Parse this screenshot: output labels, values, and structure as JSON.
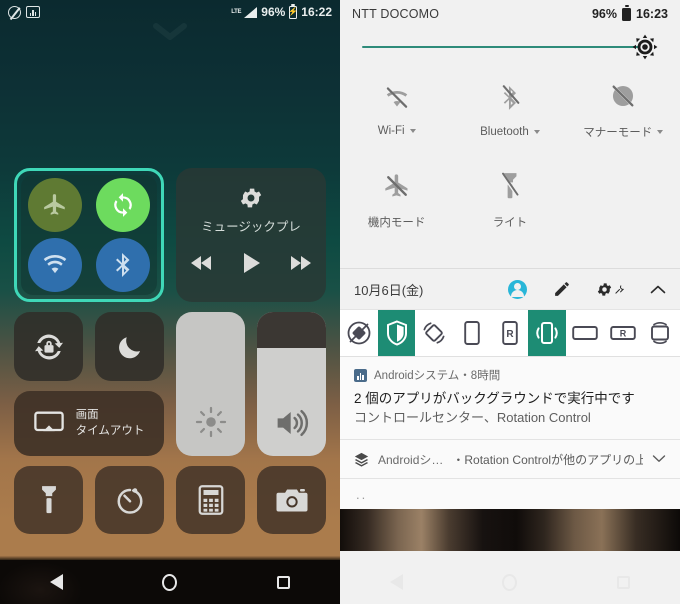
{
  "left": {
    "status_bar": {
      "dnd_icon": "do-not-disturb-icon",
      "stats_icon": "data-usage-icon",
      "network_type": "LTE",
      "battery_percent": "96%",
      "time": "16:22"
    },
    "control_center": {
      "connectivity": {
        "highlight_color": "#3fd8b8",
        "tiles": [
          {
            "name": "airplane-mode",
            "icon": "airplane-icon",
            "color": "#5f7a33",
            "state": "off"
          },
          {
            "name": "mobile-data",
            "icon": "sync-arrows-icon",
            "color": "#6ddb5e",
            "state": "on"
          },
          {
            "name": "wifi",
            "icon": "wifi-icon",
            "color": "#2f6fad",
            "state": "on"
          },
          {
            "name": "bluetooth",
            "icon": "bluetooth-icon",
            "color": "#2f6fad",
            "state": "on"
          }
        ]
      },
      "music": {
        "title": "ミュージックプレ",
        "settings_icon": "gear-icon",
        "prev_label": "previous-track",
        "play_label": "play",
        "next_label": "next-track"
      },
      "rotation_lock_icon": "rotation-lock-icon",
      "night_mode_icon": "moon-icon",
      "screen_timeout": {
        "label": "画面\nタイムアウト",
        "icon": "screen-cast-icon"
      },
      "brightness": {
        "icon": "sun-icon",
        "level": 100
      },
      "volume": {
        "icon": "speaker-icon",
        "level": 75
      },
      "shortcuts": [
        {
          "name": "flashlight",
          "icon": "flashlight-icon"
        },
        {
          "name": "timer",
          "icon": "timer-icon"
        },
        {
          "name": "calculator",
          "icon": "calculator-icon"
        },
        {
          "name": "camera",
          "icon": "camera-icon"
        }
      ]
    }
  },
  "right": {
    "status_bar": {
      "carrier": "NTT DOCOMO",
      "battery_percent": "96%",
      "time": "16:23"
    },
    "brightness_slider": {
      "value": 97,
      "icon": "brightness-icon",
      "track_color": "#2e8b7a"
    },
    "quick_settings": [
      {
        "name": "wifi",
        "label": "Wi-Fi",
        "icon": "wifi-off-icon",
        "state": "off",
        "has_caret": true
      },
      {
        "name": "bluetooth",
        "label": "Bluetooth",
        "icon": "bluetooth-off-icon",
        "state": "off",
        "has_caret": true
      },
      {
        "name": "manner-mode",
        "label": "マナーモード",
        "icon": "vibrate-off-icon",
        "state": "off",
        "has_caret": true
      },
      {
        "name": "airplane-mode",
        "label": "機内モード",
        "icon": "airplane-off-icon",
        "state": "off",
        "has_caret": false
      },
      {
        "name": "flashlight",
        "label": "ライト",
        "icon": "flashlight-off-icon",
        "state": "off",
        "has_caret": false
      }
    ],
    "date_bar": {
      "date": "10月6日(金)",
      "avatar_icon": "user-avatar-icon",
      "edit_icon": "pencil-icon",
      "settings_icon": "gear-icon",
      "collapse_icon": "chevron-up-icon"
    },
    "rotation_control": {
      "active_color": "#1d8c74",
      "items": [
        {
          "name": "rotation-auto-disabled",
          "icon": "rotate-slash-icon",
          "active": false
        },
        {
          "name": "rotation-guard",
          "icon": "shield-icon",
          "active": true
        },
        {
          "name": "rotation-auto",
          "icon": "auto-rotate-icon",
          "active": false
        },
        {
          "name": "rotation-portrait",
          "icon": "portrait-icon",
          "active": false
        },
        {
          "name": "rotation-portrait-reverse",
          "icon": "portrait-reverse-icon",
          "active": false
        },
        {
          "name": "rotation-sensor-portrait",
          "icon": "sensor-portrait-icon",
          "active": true
        },
        {
          "name": "rotation-landscape",
          "icon": "landscape-icon",
          "active": false
        },
        {
          "name": "rotation-landscape-reverse",
          "icon": "landscape-reverse-icon",
          "active": false
        },
        {
          "name": "rotation-auto-full",
          "icon": "full-rotate-icon",
          "active": false
        }
      ]
    },
    "notifications": [
      {
        "app": "Androidシステム・8時間",
        "app_icon": "android-system-icon",
        "title": "2 個のアプリがバックグラウンドで実行中です",
        "body": "コントロールセンター、Rotation Control"
      },
      {
        "app": "Androidシ…",
        "app_icon": "layers-icon",
        "text": "・Rotation Controlが他のアプリの上に表示され…",
        "expand_icon": "chevron-down-icon"
      }
    ],
    "handle_text": ".."
  },
  "navbar": {
    "back_label": "back-button",
    "home_label": "home-button",
    "recents_label": "recents-button"
  }
}
